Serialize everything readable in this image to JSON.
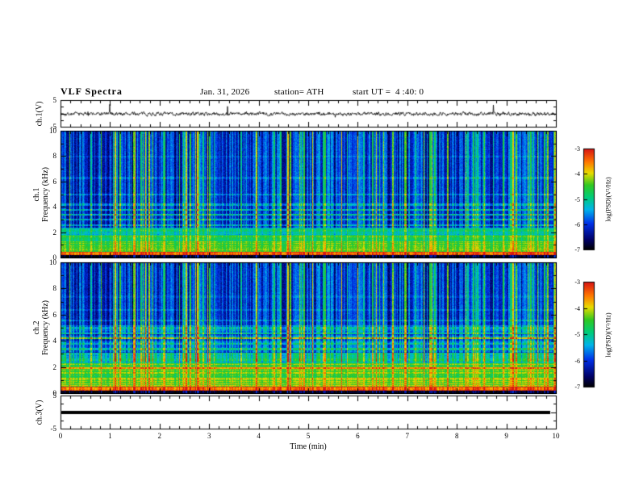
{
  "header": {
    "title": "VLF Spectra",
    "date": "Jan. 31, 2026",
    "station": "station= ATH",
    "start_ut": "start UT =  4 :40: 0"
  },
  "x_axis": {
    "label": "Time (min)",
    "range": [
      0,
      10
    ],
    "ticks": [
      0,
      1,
      2,
      3,
      4,
      5,
      6,
      7,
      8,
      9,
      10
    ]
  },
  "colorbar": {
    "label": "log(PSD)(V²/Hz)",
    "ticks": [
      -3,
      -4,
      -5,
      -6,
      -7
    ],
    "range": [
      -7,
      -3
    ]
  },
  "colormap": [
    {
      "v": 0.0,
      "color": "#000000"
    },
    {
      "v": 0.1,
      "color": "#000066"
    },
    {
      "v": 0.26,
      "color": "#0030e8"
    },
    {
      "v": 0.4,
      "color": "#00b4e8"
    },
    {
      "v": 0.52,
      "color": "#00cc7a"
    },
    {
      "v": 0.64,
      "color": "#2fc822"
    },
    {
      "v": 0.76,
      "color": "#e8dc00"
    },
    {
      "v": 0.87,
      "color": "#ff7700"
    },
    {
      "v": 1.0,
      "color": "#d81414"
    }
  ],
  "chart_data": [
    {
      "type": "line",
      "name": "ch1 waveform",
      "ylabel": "ch.1(V)",
      "ylim": [
        -5,
        5
      ],
      "yticks": [
        5,
        -5
      ],
      "x_range_min": [
        0,
        10
      ],
      "description": "broadband noise around 0 V, mostly within ±1 V, sporadic impulsive spikes up to ~±3 V",
      "noise_rms_v": 0.5,
      "spike_rate": 0.004
    },
    {
      "type": "heatmap",
      "name": "ch1 spectrogram",
      "ylabel_line1": "ch.1",
      "ylabel_line2": "Frequency (kHz)",
      "ylim_khz": [
        0,
        10
      ],
      "yticks": [
        0,
        2,
        4,
        6,
        8,
        10
      ],
      "value_range_log_psd": [
        -7,
        -3
      ],
      "background_level": 0.33,
      "stripe_below_khz": 2.4,
      "bands": [
        {
          "f_low": 0.0,
          "f_high": 0.22,
          "level": 0.06
        },
        {
          "f_low": 0.22,
          "f_high": 0.5,
          "level": 0.92
        },
        {
          "f_low": 0.5,
          "f_high": 1.1,
          "level": 0.7
        },
        {
          "f_low": 1.1,
          "f_high": 1.8,
          "level": 0.63
        },
        {
          "f_low": 1.8,
          "f_high": 2.4,
          "level": 0.5
        }
      ],
      "h_lines": [
        {
          "f": 2.6,
          "level": 0.5
        },
        {
          "f": 3.0,
          "level": 0.52
        },
        {
          "f": 3.4,
          "level": 0.55
        },
        {
          "f": 3.8,
          "level": 0.52
        },
        {
          "f": 4.2,
          "level": 0.48
        },
        {
          "f": 5.0,
          "level": 0.45
        },
        {
          "f": 6.3,
          "level": 0.41
        },
        {
          "f": 8.0,
          "level": 0.38
        }
      ],
      "features": "dense vertical sferic streaks (cyan/green) on blue background; strong hum band below ~2.4 kHz; black row at 0 kHz"
    },
    {
      "type": "heatmap",
      "name": "ch2 spectrogram",
      "ylabel_line1": "ch.2",
      "ylabel_line2": "Frequency (kHz)",
      "ylim_khz": [
        0,
        10
      ],
      "yticks": [
        0,
        2,
        4,
        6,
        8,
        10
      ],
      "value_range_log_psd": [
        -7,
        -3
      ],
      "background_level": 0.33,
      "stripe_below_khz": 5.2,
      "bands": [
        {
          "f_low": 0.0,
          "f_high": 0.22,
          "level": 0.06
        },
        {
          "f_low": 0.22,
          "f_high": 0.5,
          "level": 0.95
        },
        {
          "f_low": 0.5,
          "f_high": 1.2,
          "level": 0.74
        },
        {
          "f_low": 1.2,
          "f_high": 2.3,
          "level": 0.68
        },
        {
          "f_low": 2.3,
          "f_high": 3.1,
          "level": 0.54
        },
        {
          "f_low": 3.1,
          "f_high": 5.2,
          "level": 0.4
        }
      ],
      "h_lines": [
        {
          "f": 1.95,
          "level": 0.88
        },
        {
          "f": 2.6,
          "level": 0.62
        },
        {
          "f": 3.0,
          "level": 0.58
        },
        {
          "f": 3.4,
          "level": 0.58
        },
        {
          "f": 3.8,
          "level": 0.56
        },
        {
          "f": 4.25,
          "level": 0.78
        },
        {
          "f": 4.6,
          "level": 0.56
        },
        {
          "f": 5.0,
          "level": 0.54
        },
        {
          "f": 5.6,
          "level": 0.44
        },
        {
          "f": 6.4,
          "level": 0.4
        },
        {
          "f": 7.4,
          "level": 0.37
        }
      ],
      "features": "same sferic streaks as ch.1; stronger hum harmonics: yellow-green band below ~2.3 kHz, orange line near 4.3 kHz, red line near 2.0 kHz"
    },
    {
      "type": "line",
      "name": "ch3 waveform",
      "ylabel": "ch.3(V)",
      "ylim": [
        -5,
        5
      ],
      "yticks": [
        5,
        -5
      ],
      "description": "flat thick black line at 0 V (no signal)",
      "flat_value_v": 0
    }
  ]
}
